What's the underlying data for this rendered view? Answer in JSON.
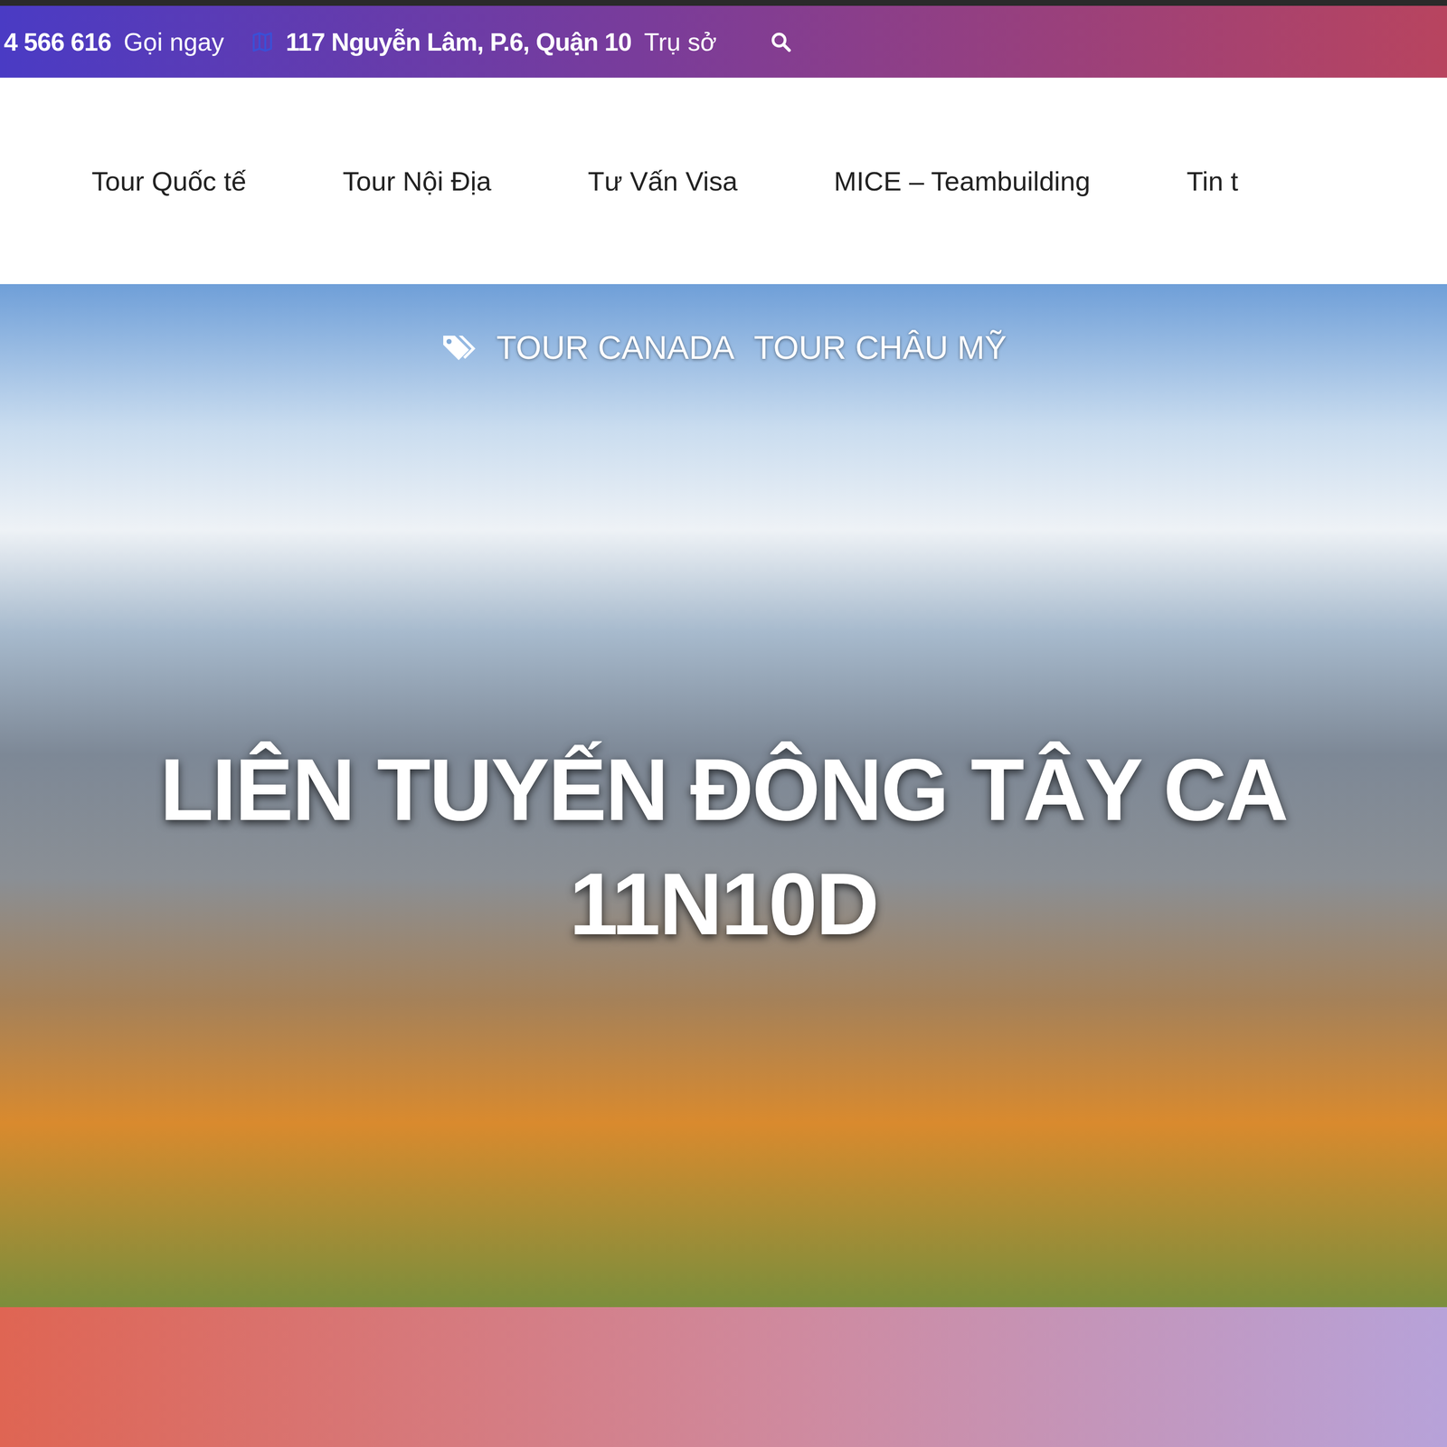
{
  "top_bar": {
    "phone": "4 566 616",
    "phone_label": "Gọi ngay",
    "address": "117 Nguyễn Lâm, P.6, Quận 10",
    "address_label": "Trụ sở"
  },
  "nav": {
    "items": [
      {
        "label": "Tour Quốc tế"
      },
      {
        "label": "Tour Nội Địa"
      },
      {
        "label": "Tư Vấn Visa"
      },
      {
        "label": "MICE – Teambuilding"
      },
      {
        "label": "Tin t"
      }
    ]
  },
  "hero": {
    "tags": [
      "TOUR CANADA",
      "TOUR CHÂU MỸ"
    ],
    "title_lines": [
      "LIÊN TUYẾN ĐÔNG TÂY CA",
      "11N10D"
    ]
  }
}
